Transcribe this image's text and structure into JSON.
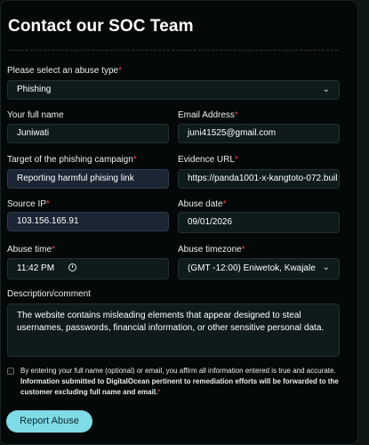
{
  "title": "Contact our SOC Team",
  "abuse_type": {
    "label": "Please select an abuse type",
    "required_mark": "*",
    "value": "Phishing"
  },
  "full_name": {
    "label": "Your full name",
    "value": "Juniwati"
  },
  "email": {
    "label": "Email Address",
    "required_mark": "*",
    "value": "juni41525@gmail.com"
  },
  "target": {
    "label": "Target of the phishing campaign",
    "required_mark": "*",
    "value": "Reporting harmful phising link"
  },
  "evidence_url": {
    "label": "Evidence URL",
    "required_mark": "*",
    "value": "https://panda1001-x-kangtoto-072.buil"
  },
  "source_ip": {
    "label": "Source IP",
    "required_mark": "*",
    "value": "103.156.165.91"
  },
  "abuse_date": {
    "label": "Abuse date",
    "required_mark": "*",
    "value": "09/01/2026"
  },
  "abuse_time": {
    "label": "Abuse time",
    "required_mark": "*",
    "value": "11:42 PM"
  },
  "abuse_timezone": {
    "label": "Abuse timezone",
    "required_mark": "*",
    "value": "(GMT -12:00) Eniwetok, Kwajale"
  },
  "description": {
    "label": "Description/comment",
    "value": "The website contains misleading elements that appear designed to steal usernames, passwords, financial information, or other sensitive personal data."
  },
  "consent": {
    "text": "By entering your full name (optional) or email, you affirm all information entered is true and accurate.",
    "bold_text": "Information submitted to DigitalOcean pertinent to remediation efforts will be forwarded to the customer excluding full name and email.",
    "required_mark": "*",
    "checked": false
  },
  "submit_label": "Report Abuse",
  "icons": {
    "select": "chevron-down-icon",
    "time": "clock-icon"
  },
  "colors": {
    "accent_button": "#7fdbe6",
    "required": "#e5484d",
    "background": "#050808"
  }
}
